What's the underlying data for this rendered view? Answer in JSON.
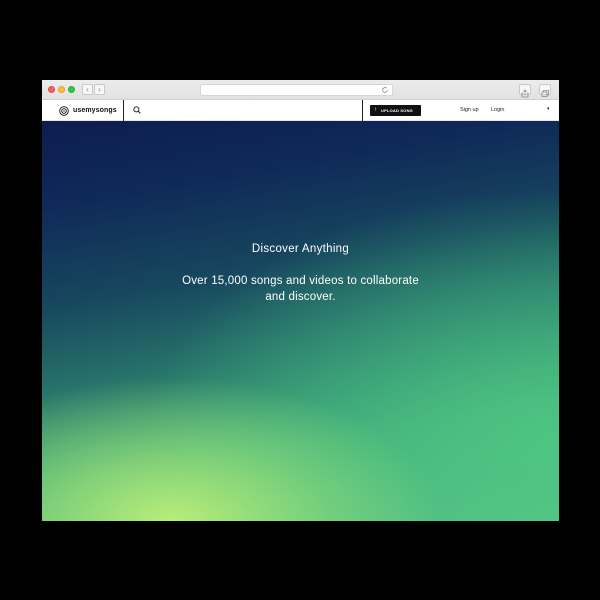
{
  "browser": {
    "back_glyph": "‹",
    "forward_glyph": "›",
    "reload_icon": "reload-icon",
    "share_icon": "share-icon",
    "tabs_icon": "tabs-icon"
  },
  "header": {
    "logo_text": "usemysongs",
    "logo_icon": "logo-icon",
    "search_icon": "search-icon",
    "upload_label": "UPLOAD SONG",
    "upload_glyph": "↑",
    "signup_label": "Sign up",
    "login_label": "Login",
    "menu_caret": "▾"
  },
  "hero": {
    "title": "Discover Anything",
    "subtitle": "Over 15,000 songs and videos to collaborate and discover."
  },
  "colors": {
    "hero_top": "#0d1d4e",
    "hero_bottom_left": "#bef078",
    "hero_bottom_right": "#5cc487",
    "button_bg": "#111111"
  }
}
